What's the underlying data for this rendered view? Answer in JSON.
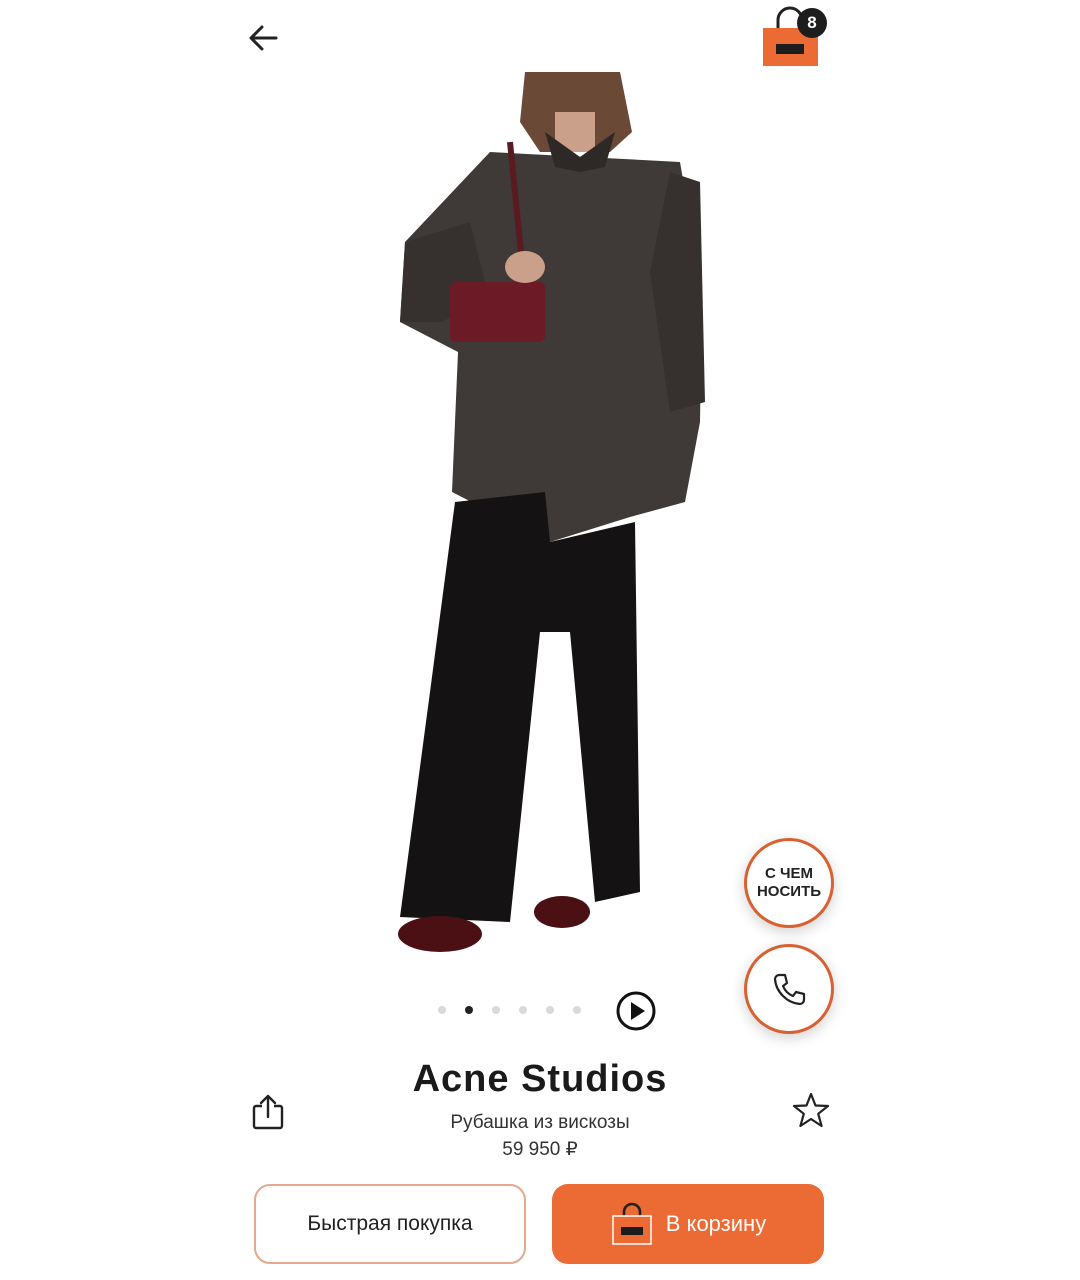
{
  "header": {
    "back_icon": "arrow-left-icon",
    "cart_icon": "shopping-bag-icon",
    "cart_count": "8",
    "accent_color": "#ec6a34"
  },
  "gallery": {
    "total_slides": 6,
    "active_slide": 2,
    "play_icon": "play-circle-icon"
  },
  "floating": {
    "outfit_label_line1": "С ЧЕМ",
    "outfit_label_line2": "НОСИТЬ",
    "call_icon": "phone-icon"
  },
  "product": {
    "brand": "Acne Studios",
    "name": "Рубашка из вискозы",
    "price": "59 950 ₽",
    "share_icon": "share-icon",
    "favorite_icon": "star-icon"
  },
  "actions": {
    "quick_buy_label": "Быстрая покупка",
    "add_to_cart_label": "В корзину"
  }
}
